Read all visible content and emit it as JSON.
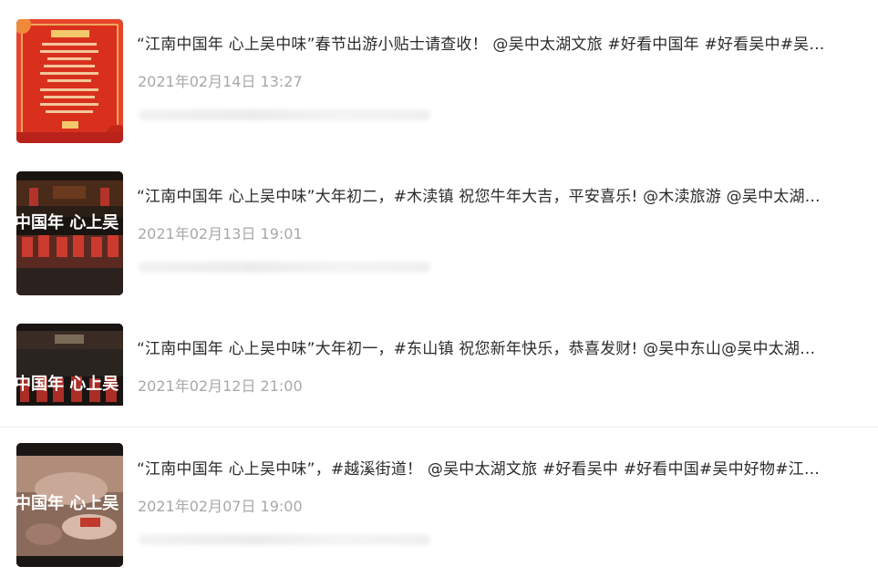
{
  "posts": [
    {
      "title": "“江南中国年 心上吴中味”春节出游小贴士请查收！ @吴中太湖文旅 #好看中国年 #好看吴中#吴…",
      "date": "2021年02月14日 13:27",
      "thumb_icon": "red-poster-thumbnail"
    },
    {
      "title": "“江南中国年 心上吴中味”大年初二，#木渎镇 祝您牛年大吉，平安喜乐! @木渎旅游 @吴中太湖…",
      "date": "2021年02月13日 19:01",
      "thumb_icon": "video-thumbnail",
      "thumb_overlay": "中国年 心上吴"
    },
    {
      "title": "“江南中国年 心上吴中味”大年初一，#东山镇 祝您新年快乐，恭喜发财! @吴中东山@吴中太湖…",
      "date": "2021年02月12日 21:00",
      "thumb_icon": "video-thumbnail",
      "thumb_overlay": "中国年 心上吴"
    },
    {
      "title": "“江南中国年 心上吴中味”，#越溪街道！ @吴中太湖文旅 #好看吴中 #好看中国#吴中好物#江…",
      "date": "2021年02月07日 19:00",
      "thumb_icon": "video-thumbnail",
      "thumb_overlay": "中国年 心上吴"
    }
  ],
  "colors": {
    "title": "#2b2b2b",
    "date": "#a8a8a8",
    "poster_red": "#d9301e",
    "poster_gold": "#f3c96b"
  }
}
